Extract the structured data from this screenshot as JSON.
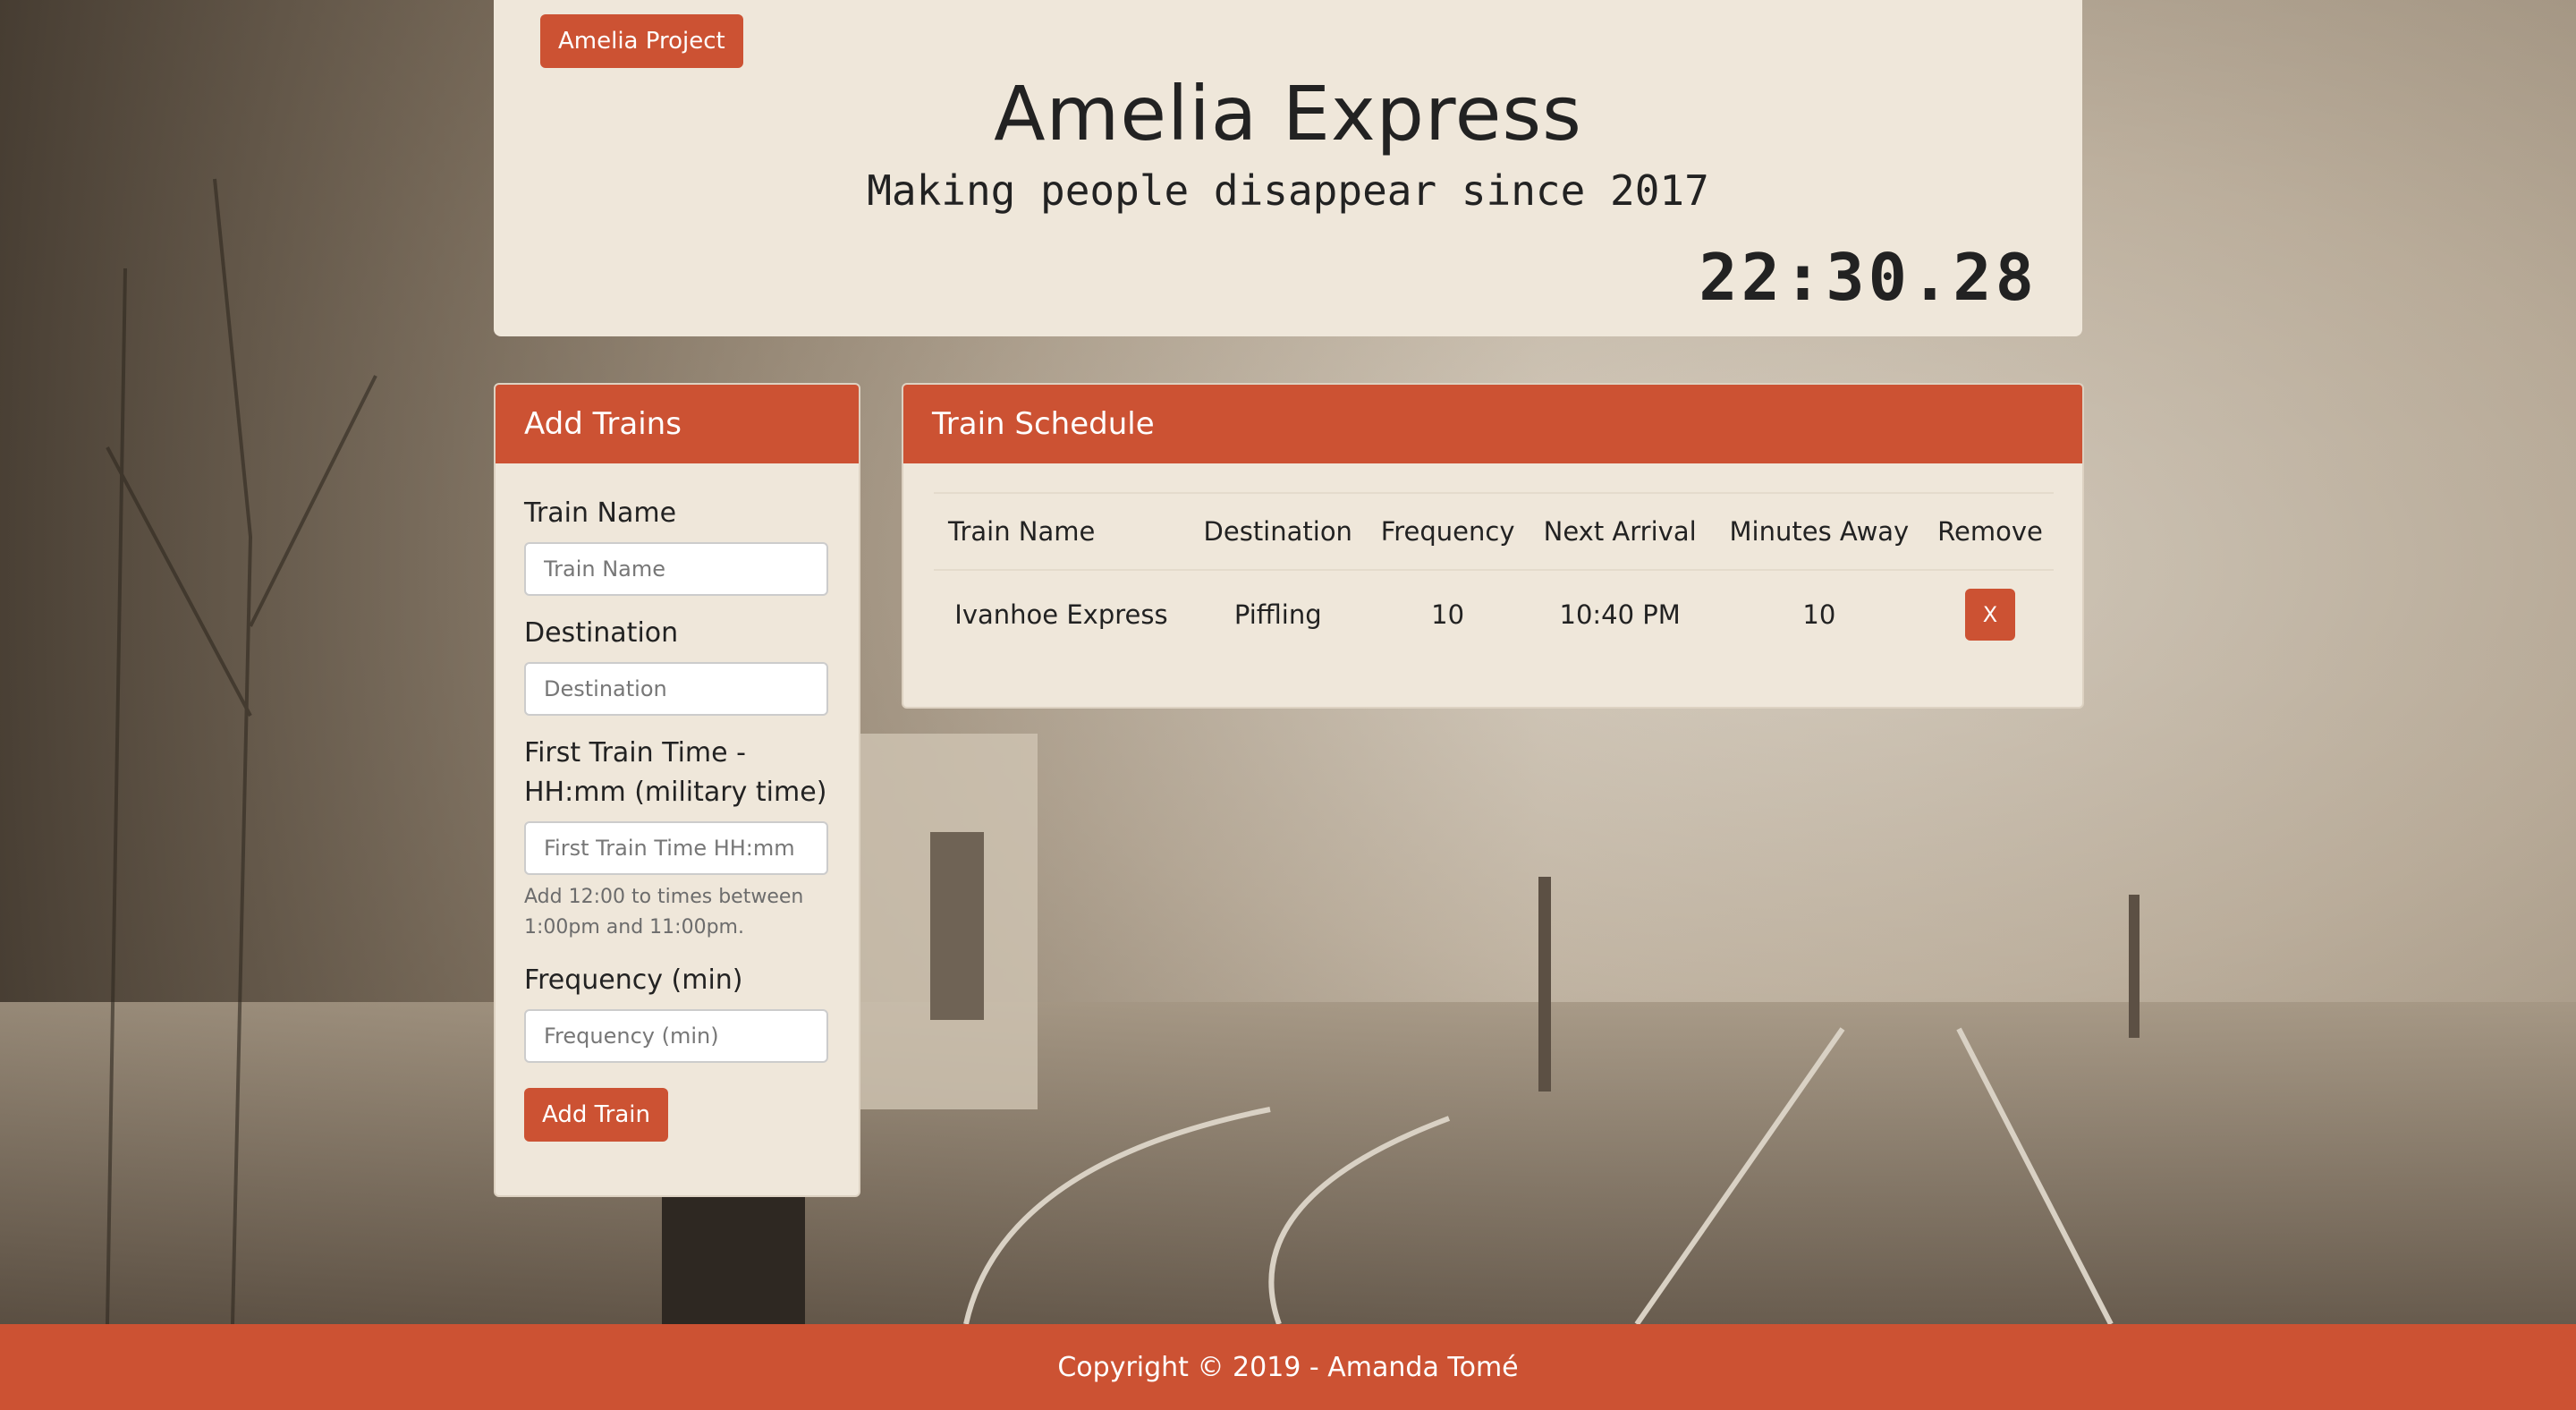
{
  "header": {
    "project_button": "Amelia Project",
    "title": "Amelia Express",
    "subtitle": "Making people disappear since 2017",
    "clock": "22:30.28"
  },
  "add_trains": {
    "heading": "Add Trains",
    "fields": [
      {
        "label": "Train Name",
        "placeholder": "Train Name"
      },
      {
        "label": "Destination",
        "placeholder": "Destination"
      },
      {
        "label": "First Train Time - HH:mm (military time)",
        "placeholder": "First Train Time HH:mm",
        "hint": "Add 12:00 to times between 1:00pm and 11:00pm."
      },
      {
        "label": "Frequency (min)",
        "placeholder": "Frequency (min)"
      }
    ],
    "submit_label": "Add Train"
  },
  "schedule": {
    "heading": "Train Schedule",
    "columns": [
      "Train Name",
      "Destination",
      "Frequency",
      "Next Arrival",
      "Minutes Away",
      "Remove"
    ],
    "rows": [
      {
        "train_name": "Ivanhoe Express",
        "destination": "Piffling",
        "frequency": "10",
        "next_arrival": "10:40 PM",
        "minutes_away": "10",
        "remove_label": "X"
      }
    ]
  },
  "footer": {
    "text": "Copyright © 2019 - Amanda Tomé"
  },
  "colors": {
    "accent": "#cc5233",
    "panel": "#efe7da"
  }
}
